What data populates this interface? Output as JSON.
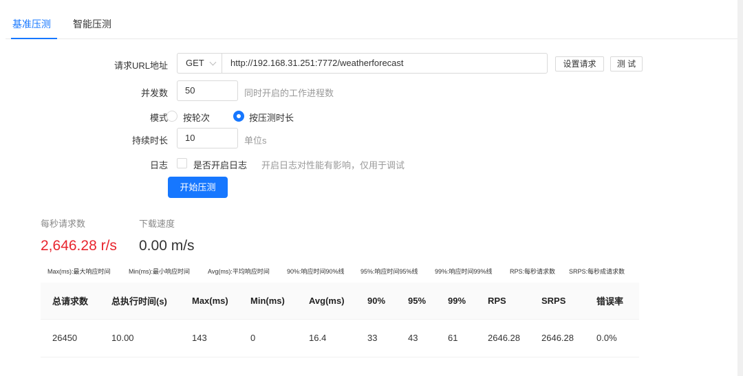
{
  "tabs": [
    {
      "label": "基准压测",
      "active": true
    },
    {
      "label": "智能压测",
      "active": false
    }
  ],
  "form": {
    "url_label": "请求URL地址",
    "method": "GET",
    "url": "http://192.168.31.251:7772/weatherforecast",
    "set_request_label": "设置请求",
    "test_label": "测 试",
    "concurrency_label": "并发数",
    "concurrency_value": "50",
    "concurrency_help": "同时开启的工作进程数",
    "mode_label": "模式",
    "mode_options": [
      "按轮次",
      "按压测时长"
    ],
    "mode_selected": "按压测时长",
    "duration_label": "持续时长",
    "duration_value": "10",
    "duration_help": "单位s",
    "log_label": "日志",
    "log_checkbox_label": "是否开启日志",
    "log_help": "开启日志对性能有影响，仅用于调试",
    "log_checked": false,
    "start_label": "开始压测"
  },
  "stats": {
    "rps_title": "每秒请求数",
    "rps_value": "2,646.28 r/s",
    "download_title": "下载速度",
    "download_value": "0.00 m/s"
  },
  "legend": [
    "Max(ms):最大响应时间",
    "Min(ms):最小响应时间",
    "Avg(ms):平均响应时间",
    "90%:响应时间90%线",
    "95%:响应时间95%线",
    "99%:响应时间99%线",
    "RPS:每秒请求数",
    "SRPS:每秒成请求数"
  ],
  "table": {
    "headers": [
      "总请求数",
      "总执行时间(s)",
      "Max(ms)",
      "Min(ms)",
      "Avg(ms)",
      "90%",
      "95%",
      "99%",
      "RPS",
      "SRPS",
      "错误率"
    ],
    "rows": [
      [
        "26450",
        "10.00",
        "143",
        "0",
        "16.4",
        "33",
        "43",
        "61",
        "2646.28",
        "2646.28",
        "0.0%"
      ]
    ]
  },
  "colors": {
    "accent": "#1677ff",
    "rps_value": "#e8252e",
    "download_value": "#333333"
  }
}
